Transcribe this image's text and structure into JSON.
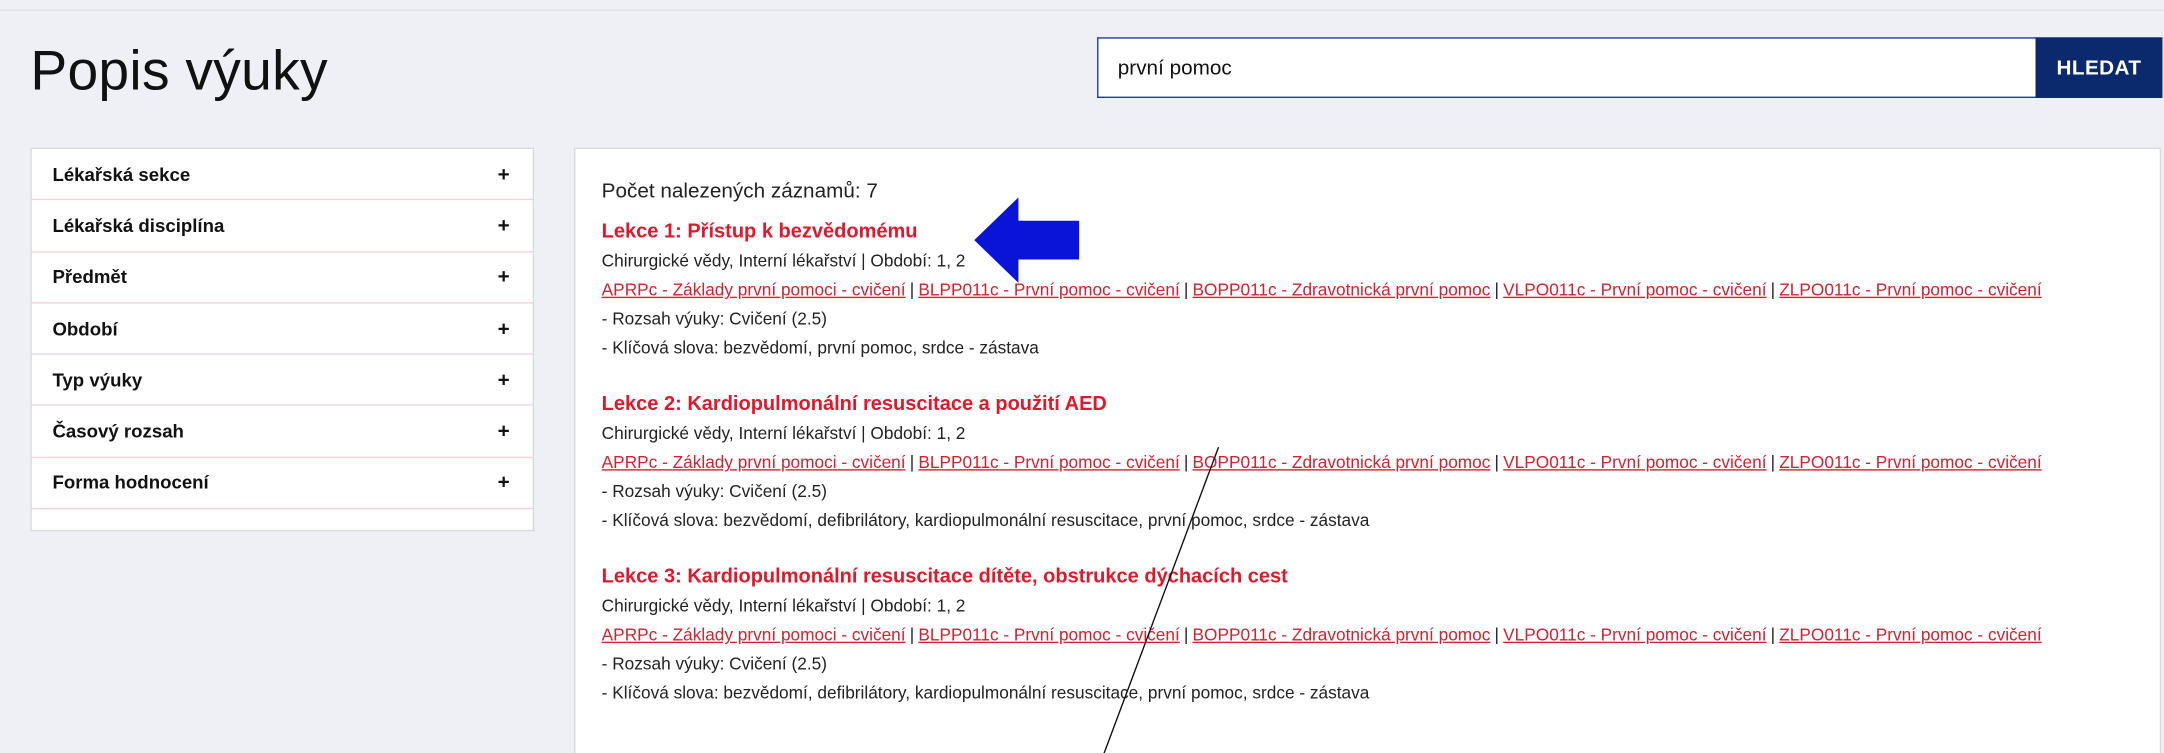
{
  "page_title": "Popis výuky",
  "search": {
    "value": "první pomoc",
    "button_label": "HLEDAT"
  },
  "filters": [
    {
      "label": "Lékařská sekce",
      "toggle": "+"
    },
    {
      "label": "Lékařská disciplína",
      "toggle": "+"
    },
    {
      "label": "Předmět",
      "toggle": "+"
    },
    {
      "label": "Období",
      "toggle": "+"
    },
    {
      "label": "Typ výuky",
      "toggle": "+"
    },
    {
      "label": "Časový rozsah",
      "toggle": "+"
    },
    {
      "label": "Forma hodnocení",
      "toggle": "+"
    }
  ],
  "results": {
    "count_text": "Počet nalezených záznamů: 7",
    "lessons": [
      {
        "title": "Lekce 1: Přístup k bezvědomému",
        "meta": "Chirurgické vědy, Interní lékařství | Období: 1, 2",
        "links": [
          "APRPc - Základy první pomoci - cvičení",
          "BLPP011c - První pomoc - cvičení",
          "BOPP011c - Zdravotnická první pomoc",
          "VLPO011c - První pomoc - cvičení",
          "ZLPO011c - První pomoc - cvičení"
        ],
        "scope": "- Rozsah výuky: Cvičení (2.5)",
        "keywords": "- Klíčová slova: bezvědomí, první pomoc, srdce - zástava"
      },
      {
        "title": "Lekce 2: Kardiopulmonální resuscitace a použití AED",
        "meta": "Chirurgické vědy, Interní lékařství | Období: 1, 2",
        "links": [
          "APRPc - Základy první pomoci - cvičení",
          "BLPP011c - První pomoc - cvičení",
          "BOPP011c - Zdravotnická první pomoc",
          "VLPO011c - První pomoc - cvičení",
          "ZLPO011c - První pomoc - cvičení"
        ],
        "scope": "- Rozsah výuky: Cvičení (2.5)",
        "keywords": "- Klíčová slova: bezvědomí, defibrilátory, kardiopulmonální resuscitace, první pomoc, srdce - zástava"
      },
      {
        "title": "Lekce 3: Kardiopulmonální resuscitace dítěte, obstrukce dýchacích cest",
        "meta": "Chirurgické vědy, Interní lékařství | Období: 1, 2",
        "links": [
          "APRPc - Základy první pomoci - cvičení",
          "BLPP011c - První pomoc - cvičení",
          "BOPP011c - Zdravotnická první pomoc",
          "VLPO011c - První pomoc - cvičení",
          "ZLPO011c - První pomoc - cvičení"
        ],
        "scope": "- Rozsah výuky: Cvičení (2.5)",
        "keywords": "- Klíčová slova: bezvědomí, defibrilátory, kardiopulmonální resuscitace, první pomoc, srdce - zástava"
      }
    ]
  },
  "annotations": {
    "arrow_color": "#0a14d8",
    "arrow_icon": "left-arrow-icon"
  },
  "colors": {
    "accent_red": "#e1182b",
    "button_navy": "#0b2a6d",
    "page_bg": "#eef0f6"
  }
}
